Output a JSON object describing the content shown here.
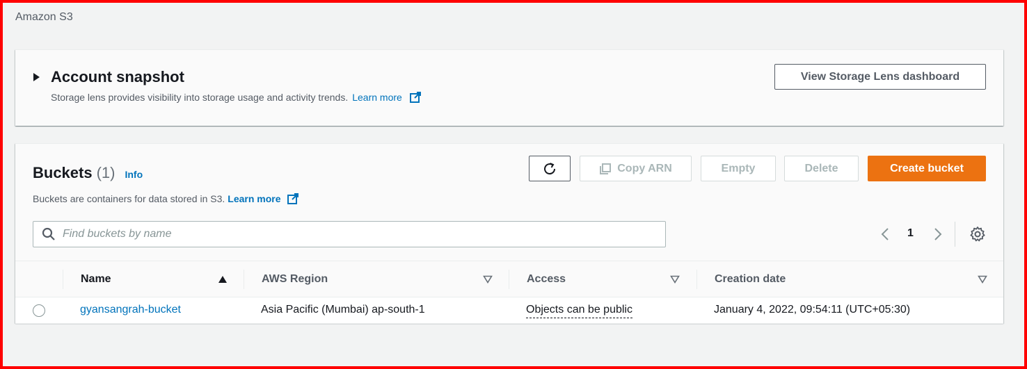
{
  "breadcrumb": "Amazon S3",
  "snapshot": {
    "title": "Account snapshot",
    "description": "Storage lens provides visibility into storage usage and activity trends.",
    "learn_more": "Learn more",
    "lens_button": "View Storage Lens dashboard"
  },
  "buckets": {
    "title": "Buckets",
    "count": "(1)",
    "info": "Info",
    "description": "Buckets are containers for data stored in S3.",
    "learn_more": "Learn more",
    "copy_arn": "Copy ARN",
    "empty": "Empty",
    "delete": "Delete",
    "create": "Create bucket",
    "search_placeholder": "Find buckets by name",
    "page": "1",
    "columns": {
      "name": "Name",
      "region": "AWS Region",
      "access": "Access",
      "date": "Creation date"
    },
    "rows": [
      {
        "name": "gyansangrah-bucket",
        "region": "Asia Pacific (Mumbai) ap-south-1",
        "access": "Objects can be public",
        "date": "January 4, 2022, 09:54:11 (UTC+05:30)"
      }
    ]
  },
  "colors": {
    "accent": "#ec7211",
    "link": "#0073bb",
    "frame": "#ff0000"
  }
}
